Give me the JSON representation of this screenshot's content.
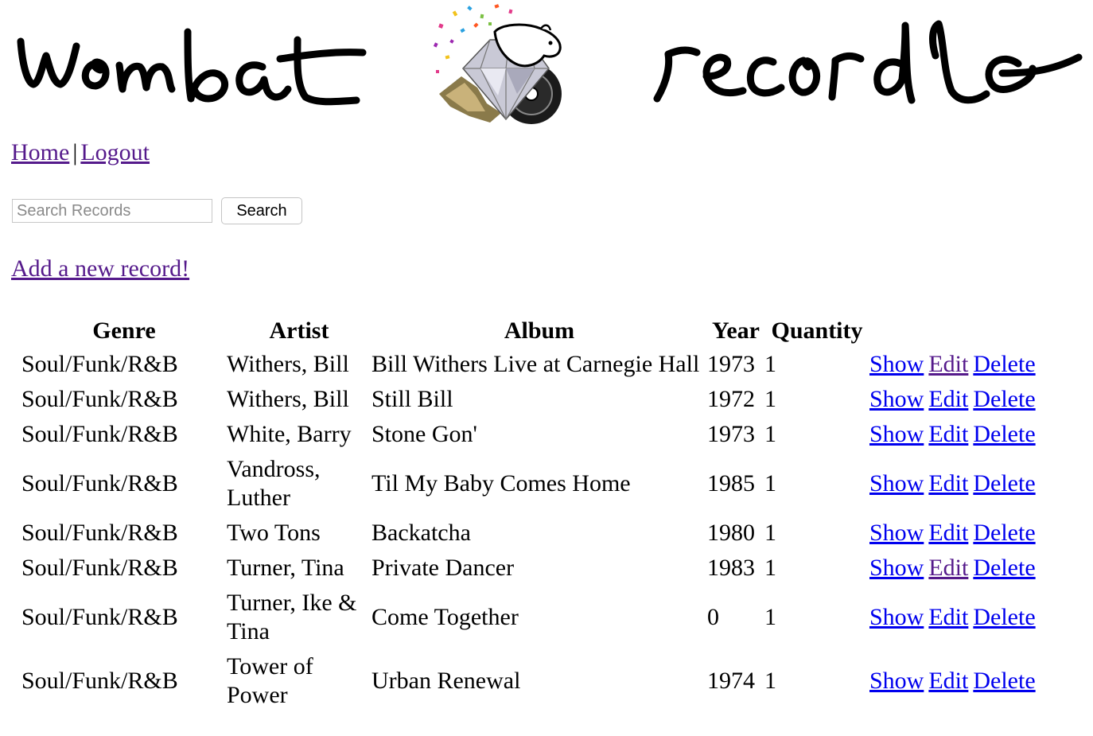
{
  "header": {
    "logo_left_text": "wombat",
    "logo_right_text": "records",
    "logo_icon": "wombat-diamond-record-icon"
  },
  "nav": {
    "home": "Home",
    "separator": "|",
    "logout": "Logout"
  },
  "search": {
    "placeholder": "Search Records",
    "value": "",
    "button_label": "Search"
  },
  "add_record_label": "Add a new record!",
  "table": {
    "columns": [
      "Genre",
      "Artist",
      "Album",
      "Year",
      "Quantity"
    ],
    "rows": [
      {
        "genre": "Soul/Funk/R&B",
        "artist": "Withers, Bill",
        "album": "Bill Withers Live at Carnegie Hall",
        "year": "1973",
        "quantity": "1",
        "edit_visited": true
      },
      {
        "genre": "Soul/Funk/R&B",
        "artist": "Withers, Bill",
        "album": "Still Bill",
        "year": "1972",
        "quantity": "1",
        "edit_visited": false
      },
      {
        "genre": "Soul/Funk/R&B",
        "artist": "White, Barry",
        "album": "Stone Gon'",
        "year": "1973",
        "quantity": "1",
        "edit_visited": false
      },
      {
        "genre": "Soul/Funk/R&B",
        "artist": "Vandross, Luther",
        "album": "Til My Baby Comes Home",
        "year": "1985",
        "quantity": "1",
        "edit_visited": false
      },
      {
        "genre": "Soul/Funk/R&B",
        "artist": "Two Tons",
        "album": "Backatcha",
        "year": "1980",
        "quantity": "1",
        "edit_visited": false
      },
      {
        "genre": "Soul/Funk/R&B",
        "artist": "Turner, Tina",
        "album": "Private Dancer",
        "year": "1983",
        "quantity": "1",
        "edit_visited": true
      },
      {
        "genre": "Soul/Funk/R&B",
        "artist": "Turner, Ike & Tina",
        "album": "Come Together",
        "year": "0",
        "quantity": "1",
        "edit_visited": false
      },
      {
        "genre": "Soul/Funk/R&B",
        "artist": "Tower of Power",
        "album": "Urban Renewal",
        "year": "1974",
        "quantity": "1",
        "edit_visited": false
      }
    ],
    "actions": {
      "show": "Show",
      "edit": "Edit",
      "delete": "Delete"
    }
  },
  "colors": {
    "link": "#0000ee",
    "visited_link": "#551a8b",
    "text": "#000000"
  }
}
